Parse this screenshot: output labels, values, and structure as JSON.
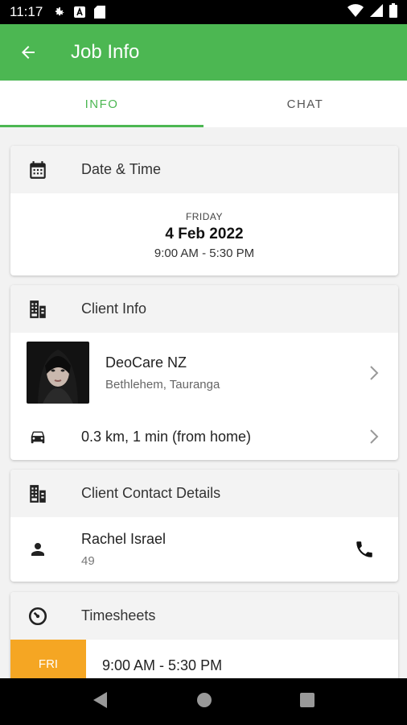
{
  "status_bar": {
    "time": "11:17"
  },
  "app_bar": {
    "title": "Job Info"
  },
  "tabs": [
    {
      "label": "INFO",
      "active": true
    },
    {
      "label": "CHAT",
      "active": false
    }
  ],
  "date_time": {
    "heading": "Date & Time",
    "day": "FRIDAY",
    "date": "4 Feb 2022",
    "time_range": "9:00 AM - 5:30 PM"
  },
  "client_info": {
    "heading": "Client Info",
    "name": "DeoCare NZ",
    "location": "Bethlehem, Tauranga",
    "distance": "0.3 km, 1 min (from home)"
  },
  "client_contact": {
    "heading": "Client Contact Details",
    "name": "Rachel Israel",
    "number": "49"
  },
  "timesheets": {
    "heading": "Timesheets",
    "day": "FRI",
    "time_range": "9:00 AM - 5:30 PM"
  },
  "colors": {
    "primary": "#4cb752",
    "accent_day": "#f5a623"
  }
}
